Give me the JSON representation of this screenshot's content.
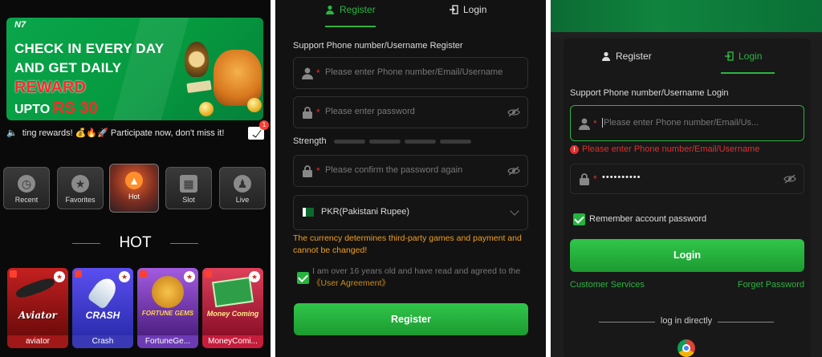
{
  "home": {
    "banner": {
      "logo": "N7",
      "line1": "CHECK IN EVERY DAY",
      "line2": "AND GET DAILY",
      "line3": "REWARD",
      "line4": "UPTO",
      "amount": "RS 30"
    },
    "marquee": "ting rewards! 💰🔥🚀 Participate now, don't miss it!",
    "mail_badge": "1",
    "categories": [
      {
        "label": "Recent",
        "icon": "clock-icon"
      },
      {
        "label": "Favorites",
        "icon": "star-icon"
      },
      {
        "label": "Hot",
        "icon": "flame-icon",
        "active": true
      },
      {
        "label": "Slot",
        "icon": "slot-machine-icon"
      },
      {
        "label": "Live",
        "icon": "live-dealer-icon"
      }
    ],
    "section_title": "HOT",
    "games": [
      {
        "name": "aviator",
        "art_text": "Aviator"
      },
      {
        "name": "Crash",
        "art_text": "CRASH"
      },
      {
        "name": "FortuneGe...",
        "art_text": "FORTUNE GEMS"
      },
      {
        "name": "MoneyComi...",
        "art_text": "Money Coming"
      }
    ]
  },
  "register": {
    "tabs": [
      {
        "label": "Register",
        "active": true
      },
      {
        "label": "Login",
        "active": false
      }
    ],
    "section_label": "Support Phone number/Username Register",
    "username_placeholder": "Please enter Phone number/Email/Username",
    "password_placeholder": "Please enter password",
    "strength_label": "Strength",
    "confirm_placeholder": "Please confirm the password again",
    "currency": "PKR(Pakistani Rupee)",
    "currency_warning": "The currency determines third-party games and payment and cannot be changed!",
    "agree_text": "I am over 16 years old and have read and agreed to the",
    "agree_link": "《User Agreement》",
    "agree_checked": true,
    "submit_label": "Register",
    "accent_color": "#2bb541"
  },
  "login": {
    "tabs": [
      {
        "label": "Register",
        "active": false
      },
      {
        "label": "Login",
        "active": true
      }
    ],
    "section_label": "Support Phone number/Username Login",
    "username_placeholder": "Please enter Phone number/Email/Us...",
    "error_message": "Please enter Phone number/Email/Username",
    "password_value": "••••••••••",
    "remember_label": "Remember account password",
    "remember_checked": true,
    "submit_label": "Login",
    "customer_services": "Customer Services",
    "forget_password": "Forget Password",
    "direct_label": "log in directly",
    "error_color": "#e03030"
  }
}
